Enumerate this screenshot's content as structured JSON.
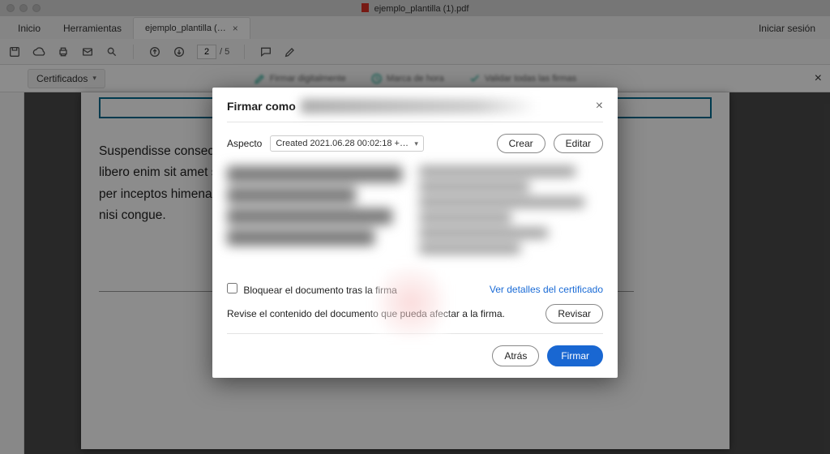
{
  "titlebar": {
    "filename": "ejemplo_plantilla (1).pdf"
  },
  "tabs": {
    "home": "Inicio",
    "tools": "Herramientas",
    "doc_short": "ejemplo_plantilla (…",
    "signin": "Iniciar sesión"
  },
  "toolbar": {
    "page_current": "2",
    "page_total": "/ 5"
  },
  "certbar": {
    "label": "Certificados",
    "action1": "Firmar digitalmente",
    "action2": "Marca de hora",
    "action3": "Validar todas las firmas"
  },
  "document": {
    "body_line1": "Suspendisse  consectetur  libero  sed  turpis  interdum  venenatis,  quis  pulvinar",
    "body_line2": "libero enim sit amet sem. Class aptent taciti sociosqu ad conubia nostra,",
    "body_line3": "per inceptos himenaeos. Aliquam ornare turpis sed aliquet, quis scelerisque",
    "body_line4": "nisi congue."
  },
  "modal": {
    "title": "Firmar como",
    "aspect_label": "Aspecto",
    "aspect_value": "Created 2021.06.28 00:02:18 +…",
    "create": "Crear",
    "edit": "Editar",
    "lock_label": "Bloquear el documento tras la firma",
    "cert_link": "Ver detalles del certificado",
    "review_text": "Revise el contenido del documento que pueda afectar a la firma.",
    "review_btn": "Revisar",
    "back": "Atrás",
    "sign": "Firmar"
  }
}
